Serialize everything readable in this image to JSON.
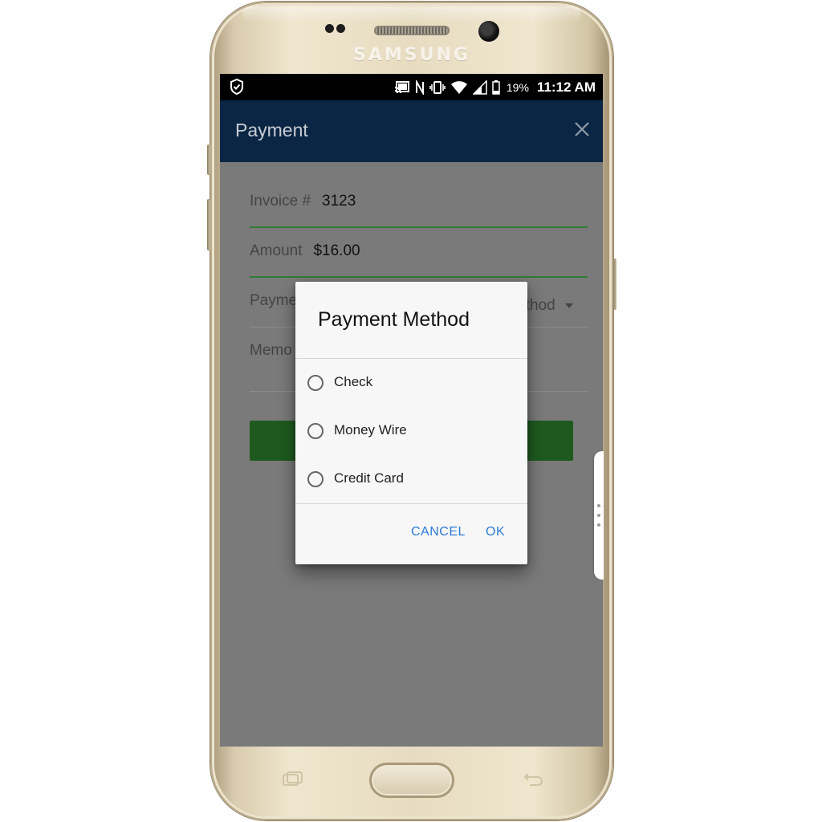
{
  "device": {
    "brand": "SAMSUNG"
  },
  "statusbar": {
    "battery_percent": "19%",
    "time": "11:12 AM",
    "icons": [
      "shield-check-icon",
      "cast-icon",
      "nfc-icon",
      "vibrate-icon",
      "wifi-icon",
      "signal-icon",
      "battery-icon"
    ]
  },
  "appbar": {
    "title": "Payment",
    "close_icon": "close-icon"
  },
  "form": {
    "invoice_label": "Invoice #",
    "invoice_value": "3123",
    "amount_label": "Amount",
    "amount_value": "$16.00",
    "payment_label_visible": "Payme",
    "payment_dropdown_tail": "ethod",
    "memo_label_visible": "Memo"
  },
  "dialog": {
    "title": "Payment Method",
    "options": [
      "Check",
      "Money Wire",
      "Credit Card"
    ],
    "cancel_label": "CANCEL",
    "ok_label": "OK"
  },
  "colors": {
    "appbar": "#0b2644",
    "accent_green": "#2e7d32",
    "dialog_button": "#2b7bd6",
    "status_bar": "#000000"
  }
}
